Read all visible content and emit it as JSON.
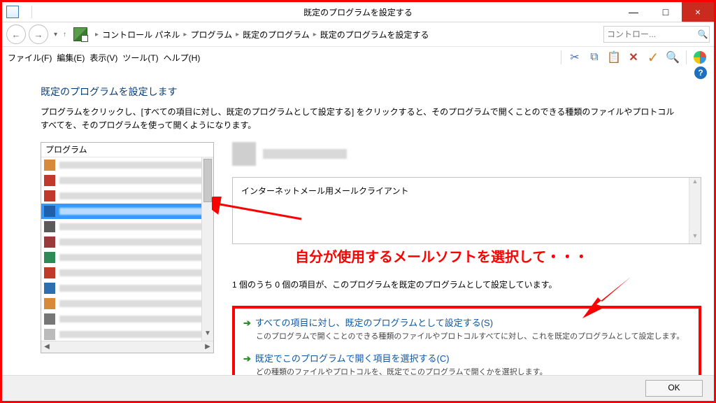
{
  "window": {
    "title": "既定のプログラムを設定する",
    "btn_min": "—",
    "btn_max": "□",
    "btn_close": "×"
  },
  "nav": {
    "back": "←",
    "fwd": "→",
    "dd": "▾",
    "up": "↑",
    "crumbs": [
      "コントロール パネル",
      "プログラム",
      "既定のプログラム",
      "既定のプログラムを設定する"
    ],
    "search_placeholder": "コントロー...",
    "search_icon": "🔍"
  },
  "menu": {
    "file": "ファイル(F)",
    "edit": "編集(E)",
    "view": "表示(V)",
    "tool": "ツール(T)",
    "help": "ヘルプ(H)"
  },
  "toolbar": {
    "cut": "✂",
    "copy": "⧉",
    "paste": "📋",
    "delete": "✕",
    "ok": "✓",
    "search": "🔍"
  },
  "page": {
    "help": "?",
    "heading": "既定のプログラムを設定します",
    "intro": "プログラムをクリックし、[すべての項目に対し、既定のプログラムとして設定する] をクリックすると、そのプログラムで開くことのできる種類のファイルやプロトコルすべてを、そのプログラムを使って開くようになります。",
    "list_header": "プログラム",
    "desc": "インターネットメール用メールクライアント",
    "status": "1 個のうち 0 個の項目が、このプログラムを既定のプログラムとして設定しています。",
    "annotation": "自分が使用するメールソフトを選択して・・・",
    "opt1_title": "すべての項目に対し、既定のプログラムとして設定する(S)",
    "opt1_desc": "このプログラムで開くことのできる種類のファイルやプロトコルすべてに対し、これを既定のプログラムとして設定します。",
    "opt2_title": "既定でこのプログラムで開く項目を選択する(C)",
    "opt2_desc": "どの種類のファイルやプロトコルを、既定でこのプログラムで開くかを選択します。",
    "arrow": "➔"
  },
  "footer": {
    "ok": "OK"
  },
  "colors": {
    "accent": "#0b57a8",
    "annot": "#ff0000",
    "selected": "#3399ff"
  },
  "list_row_icon_colors": [
    "#d68a3a",
    "#c0392b",
    "#c0392b",
    "#3399ff",
    "#5b5b5b",
    "#9b3a3a",
    "#2e8b57",
    "#c0392b",
    "#2e6fb0",
    "#d68a3a",
    "#777",
    "#bbb"
  ]
}
